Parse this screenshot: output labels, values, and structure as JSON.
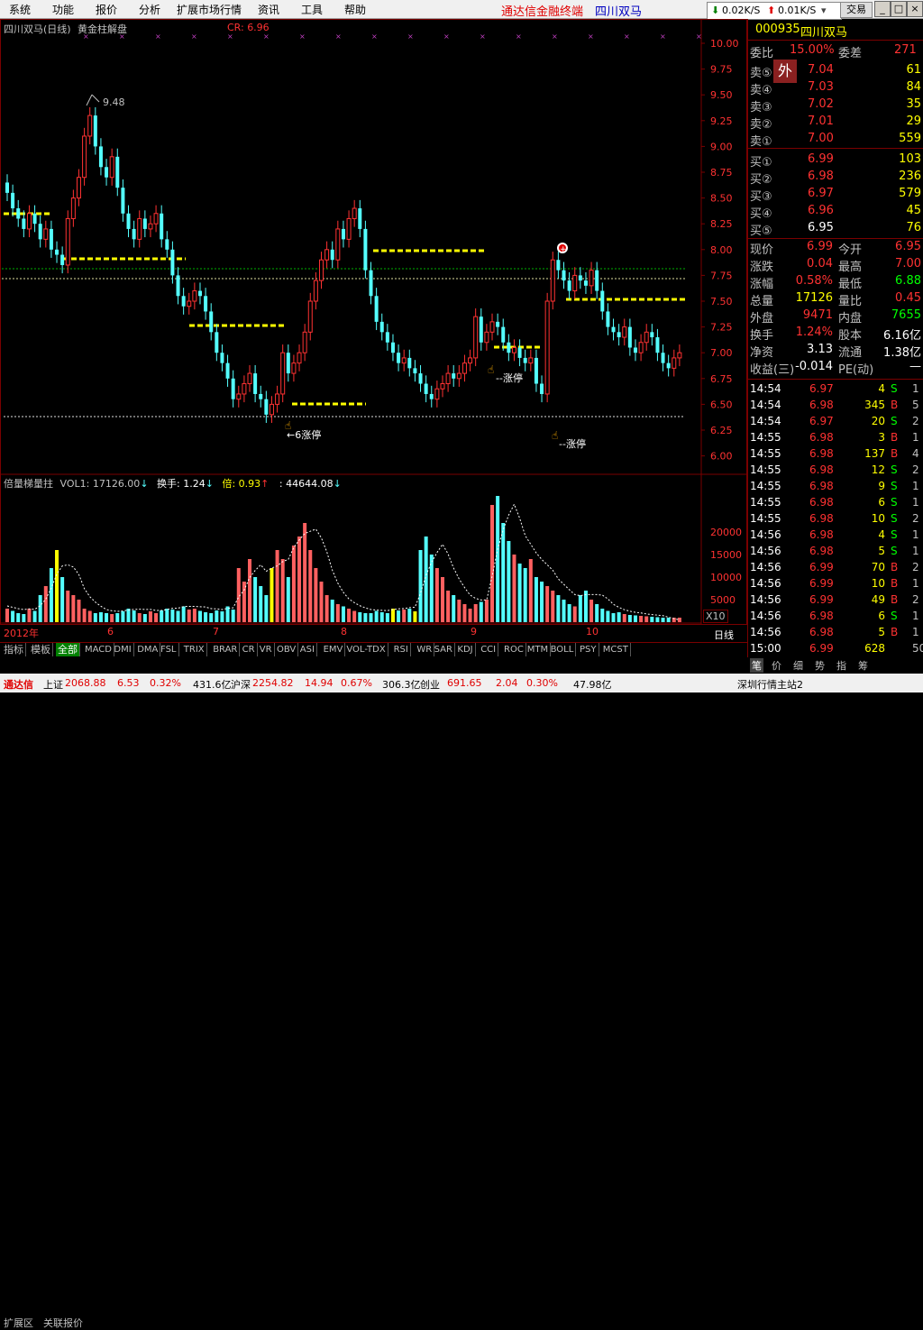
{
  "menu": {
    "items": [
      "系统",
      "功能",
      "报价",
      "分析",
      "扩展市场行情",
      "资讯",
      "工具",
      "帮助"
    ],
    "brand": "通达信金融终端",
    "stock_title": "四川双马"
  },
  "net_speed": {
    "down": "0.02K/S",
    "up": "0.01K/S",
    "trade_label": "交易"
  },
  "chart": {
    "stock_label": "四川双马(日线)",
    "indicator_label": "黄金柱解盘",
    "cr_label": "CR: 6.96",
    "high_mark": "9.48",
    "ann1": "6涨停",
    "ann2": "涨停",
    "ann3": "涨停",
    "x_labels": [
      "2012年",
      "6",
      "7",
      "8",
      "9",
      "10"
    ],
    "vol_label": "倍量梯量拄",
    "vol_vals": "VOL1: 17126.00",
    "hs_label": "换手: 1.24",
    "bei_label": "倍: 0.93",
    "amount_label": ": 44644.08",
    "x10": "X10",
    "period": "日线",
    "price_ticks": [
      "10.00",
      "9.75",
      "9.50",
      "9.25",
      "9.00",
      "8.75",
      "8.50",
      "8.25",
      "8.00",
      "7.75",
      "7.50",
      "7.25",
      "7.00",
      "6.75",
      "6.50",
      "6.25",
      "6.00"
    ],
    "vol_ticks": [
      "20000",
      "15000",
      "10000",
      "5000"
    ]
  },
  "quote": {
    "code": "000935",
    "name": "四川双马",
    "weibi_label": "委比",
    "weibi": "15.00%",
    "weicha_label": "委差",
    "weicha": "271",
    "wai_badge": "外",
    "sells": [
      {
        "label": "卖⑤",
        "price": "7.04",
        "vol": "61"
      },
      {
        "label": "卖④",
        "price": "7.03",
        "vol": "84"
      },
      {
        "label": "卖③",
        "price": "7.02",
        "vol": "35"
      },
      {
        "label": "卖②",
        "price": "7.01",
        "vol": "29"
      },
      {
        "label": "卖①",
        "price": "7.00",
        "vol": "559"
      }
    ],
    "buys": [
      {
        "label": "买①",
        "price": "6.99",
        "vol": "103"
      },
      {
        "label": "买②",
        "price": "6.98",
        "vol": "236"
      },
      {
        "label": "买③",
        "price": "6.97",
        "vol": "579"
      },
      {
        "label": "买④",
        "price": "6.96",
        "vol": "45"
      },
      {
        "label": "买⑤",
        "price": "6.95",
        "vol": "76"
      }
    ],
    "stats": [
      {
        "l1": "现价",
        "v1": "6.99",
        "l2": "今开",
        "v2": "6.95"
      },
      {
        "l1": "涨跌",
        "v1": "0.04",
        "l2": "最高",
        "v2": "7.00"
      },
      {
        "l1": "涨幅",
        "v1": "0.58%",
        "l2": "最低",
        "v2": "6.88"
      },
      {
        "l1": "总量",
        "v1": "17126",
        "l2": "量比",
        "v2": "0.45"
      },
      {
        "l1": "外盘",
        "v1": "9471",
        "l2": "内盘",
        "v2": "7655"
      },
      {
        "l1": "换手",
        "v1": "1.24%",
        "l2": "股本",
        "v2": "6.16亿"
      },
      {
        "l1": "净资",
        "v1": "3.13",
        "l2": "流通",
        "v2": "1.38亿"
      },
      {
        "l1": "收益(三)",
        "v1": "-0.014",
        "l2": "PE(动)",
        "v2": "—"
      }
    ],
    "ticks": [
      {
        "time": "14:54",
        "price": "6.97",
        "vol": "4",
        "side": "S",
        "n": "1"
      },
      {
        "time": "14:54",
        "price": "6.98",
        "vol": "345",
        "side": "B",
        "n": "5"
      },
      {
        "time": "14:54",
        "price": "6.97",
        "vol": "20",
        "side": "S",
        "n": "2"
      },
      {
        "time": "14:55",
        "price": "6.98",
        "vol": "3",
        "side": "B",
        "n": "1"
      },
      {
        "time": "14:55",
        "price": "6.98",
        "vol": "137",
        "side": "B",
        "n": "4"
      },
      {
        "time": "14:55",
        "price": "6.98",
        "vol": "12",
        "side": "S",
        "n": "2"
      },
      {
        "time": "14:55",
        "price": "6.98",
        "vol": "9",
        "side": "S",
        "n": "1"
      },
      {
        "time": "14:55",
        "price": "6.98",
        "vol": "6",
        "side": "S",
        "n": "1"
      },
      {
        "time": "14:55",
        "price": "6.98",
        "vol": "10",
        "side": "S",
        "n": "2"
      },
      {
        "time": "14:56",
        "price": "6.98",
        "vol": "4",
        "side": "S",
        "n": "1"
      },
      {
        "time": "14:56",
        "price": "6.98",
        "vol": "5",
        "side": "S",
        "n": "1"
      },
      {
        "time": "14:56",
        "price": "6.99",
        "vol": "70",
        "side": "B",
        "n": "2"
      },
      {
        "time": "14:56",
        "price": "6.99",
        "vol": "10",
        "side": "B",
        "n": "1"
      },
      {
        "time": "14:56",
        "price": "6.99",
        "vol": "49",
        "side": "B",
        "n": "2"
      },
      {
        "time": "14:56",
        "price": "6.98",
        "vol": "6",
        "side": "S",
        "n": "1"
      },
      {
        "time": "14:56",
        "price": "6.98",
        "vol": "5",
        "side": "B",
        "n": "1"
      },
      {
        "time": "15:00",
        "price": "6.99",
        "vol": "628",
        "side": "",
        "n": "50"
      }
    ],
    "bottom_tabs": [
      "笔",
      "价",
      "细",
      "势",
      "指",
      "筹"
    ]
  },
  "indicator_tabs": [
    "指标",
    "模板",
    "全部",
    "MACD",
    "DMI",
    "DMA",
    "FSL",
    "TRIX",
    "BRAR",
    "CR",
    "VR",
    "OBV",
    "ASI",
    "EMV",
    "VOL-TDX",
    "RSI",
    "WR",
    "SAR",
    "KDJ",
    "CCI",
    "ROC",
    "MTM",
    "BOLL",
    "PSY",
    "MCST"
  ],
  "panel_tabs": [
    "扩展区",
    "关联报价"
  ],
  "status": {
    "brand": "通达信",
    "sh_label": "上证",
    "sh_index": "2068.88",
    "sh_chg": "6.53",
    "sh_pct": "0.32%",
    "sh_amt": "431.6亿",
    "hs_label": "沪深",
    "hs_index": "2254.82",
    "hs_chg": "14.94",
    "hs_pct": "0.67%",
    "hs_amt": "306.3亿",
    "cy_label": "创业",
    "cy_index": "691.65",
    "cy_chg": "2.04",
    "cy_pct": "0.30%",
    "cy_amt": "47.98亿",
    "server": "深圳行情主站2"
  },
  "colors": {
    "up": "#ff3232",
    "down": "#54ffff",
    "yellow": "#ffff00",
    "frame": "#7a0000"
  }
}
